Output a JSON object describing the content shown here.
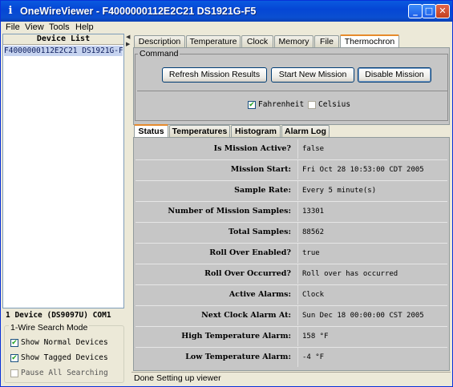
{
  "window": {
    "title": "OneWireViewer - F4000000112E2C21 DS1921G-F5",
    "app_icon": "info-i-icon",
    "controls": [
      "minimize-icon",
      "maximize-icon",
      "close-icon"
    ]
  },
  "menu": [
    "File",
    "View",
    "Tools",
    "Help"
  ],
  "device_list": {
    "header": "Device List",
    "items": [
      "F4000000112E2C21 DS1921G-F5"
    ],
    "count_text": "1 Device  (DS9097U) COM1"
  },
  "search_mode": {
    "title": "1-Wire Search Mode",
    "options": [
      {
        "label": "Show Normal Devices",
        "checked": true
      },
      {
        "label": "Show Tagged Devices",
        "checked": true
      },
      {
        "label": "Pause All Searching",
        "checked": false
      }
    ]
  },
  "top_tabs": [
    "Description",
    "Temperature",
    "Clock",
    "Memory",
    "File",
    "Thermochron"
  ],
  "top_tabs_active": "Thermochron",
  "command": {
    "title": "Command",
    "buttons": [
      "Refresh Mission Results",
      "Start New Mission",
      "Disable Mission"
    ],
    "units": [
      {
        "label": "Fahrenheit",
        "checked": true
      },
      {
        "label": "Celsius",
        "checked": false
      }
    ]
  },
  "sub_tabs": [
    "Status",
    "Temperatures",
    "Histogram",
    "Alarm Log"
  ],
  "sub_tabs_active": "Status",
  "status_rows": [
    {
      "label": "Is Mission Active?",
      "value": "false"
    },
    {
      "label": "Mission Start:",
      "value": "Fri Oct 28 10:53:00 CDT 2005"
    },
    {
      "label": "Sample Rate:",
      "value": "Every 5 minute(s)"
    },
    {
      "label": "Number of Mission Samples:",
      "value": "13301"
    },
    {
      "label": "Total Samples:",
      "value": "88562"
    },
    {
      "label": "Roll Over Enabled?",
      "value": "true"
    },
    {
      "label": "Roll Over Occurred?",
      "value": "Roll over has occurred"
    },
    {
      "label": "Active Alarms:",
      "value": "Clock"
    },
    {
      "label": "Next Clock Alarm At:",
      "value": "Sun Dec 18 00:00:00 CST 2005"
    },
    {
      "label": "High Temperature Alarm:",
      "value": "158 °F"
    },
    {
      "label": "Low Temperature Alarm:",
      "value": "-4 °F"
    }
  ],
  "status_bar": "Done Setting up viewer"
}
